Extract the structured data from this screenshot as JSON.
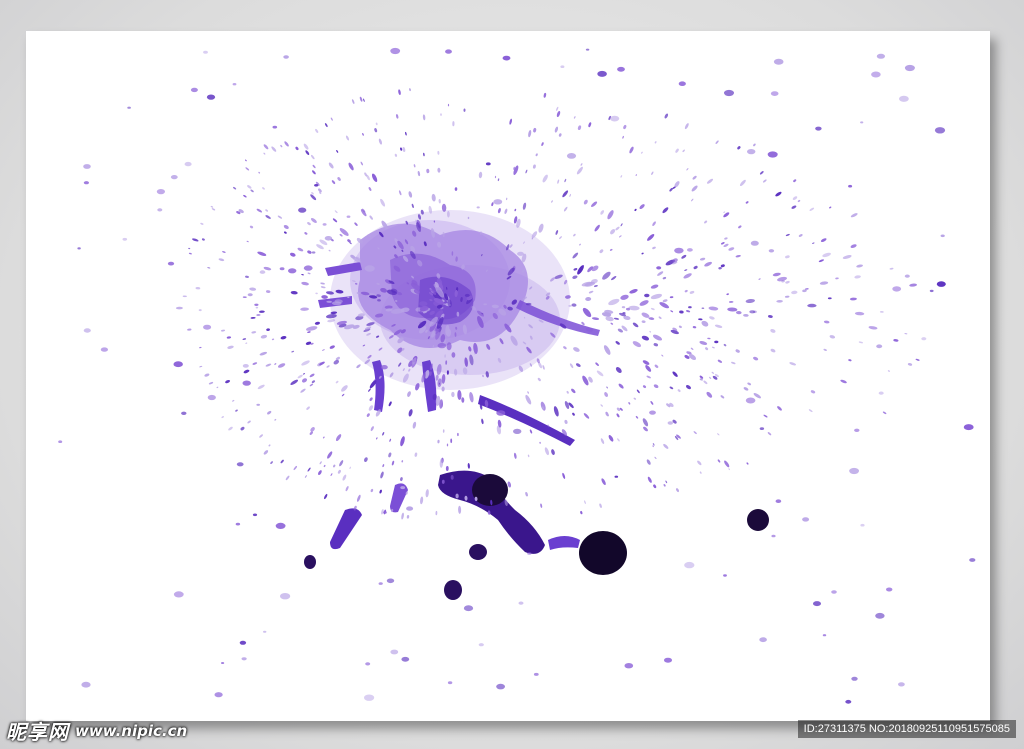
{
  "image": {
    "subject": "purple-ink-splatter",
    "colors": {
      "background": "#ffffff",
      "frame": "#d6d6d8",
      "light_purple": "#b8a3e6",
      "mid_purple": "#8a5fd8",
      "deep_purple": "#5a2fc0",
      "dark_ink": "#1b0a3a"
    }
  },
  "watermark": {
    "logo_text": "昵享网",
    "url": "www.nipic.cn",
    "id_text": "ID:27311375 NO:20180925110951575085"
  }
}
